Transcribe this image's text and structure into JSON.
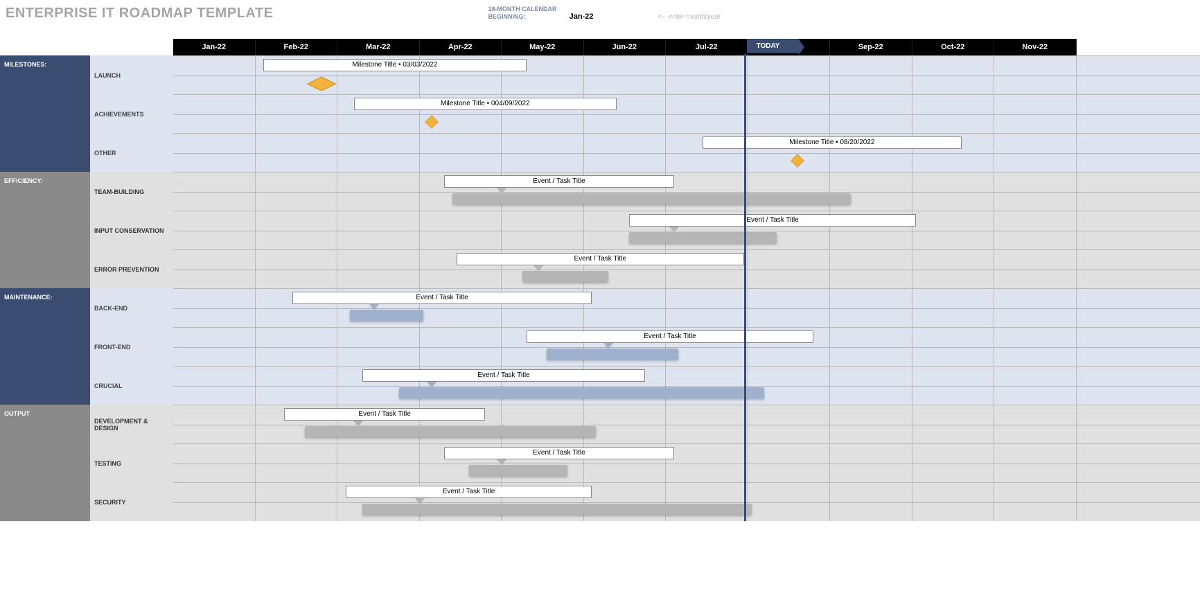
{
  "header": {
    "title": "ENTERPRISE IT ROADMAP TEMPLATE",
    "cal_line1": "18-MONTH CALENDAR",
    "cal_line2": "BEGINNING:",
    "beginning_value": "Jan-22",
    "hint": "<-- enter month/year"
  },
  "today": {
    "label": "TODAY",
    "month_index": 6.95
  },
  "months": [
    "Jan-22",
    "Feb-22",
    "Mar-22",
    "Apr-22",
    "May-22",
    "Jun-22",
    "Jul-22",
    "Aug-22",
    "Sep-22",
    "Oct-22",
    "Nov-22"
  ],
  "chart_data": {
    "type": "gantt",
    "x_unit": "month",
    "x_categories": [
      "Jan-22",
      "Feb-22",
      "Mar-22",
      "Apr-22",
      "May-22",
      "Jun-22",
      "Jul-22",
      "Aug-22",
      "Sep-22",
      "Oct-22",
      "Nov-22"
    ],
    "sections": [
      {
        "name": "MILESTONES:",
        "theme": "milestones",
        "rows": [
          {
            "name": "LAUNCH",
            "type": "milestone",
            "label": "Milestone Title  •  03/03/2022",
            "label_start": 1.1,
            "label_end": 4.3,
            "diamond_at": 1.8,
            "diamond_size": "large"
          },
          {
            "name": "ACHIEVEMENTS",
            "type": "milestone",
            "label": "Milestone Title  •  004/09/2022",
            "label_start": 2.2,
            "label_end": 5.4,
            "diamond_at": 3.15,
            "diamond_size": "small"
          },
          {
            "name": "OTHER",
            "type": "milestone",
            "label": "Milestone Title  •  08/20/2022",
            "label_start": 6.45,
            "label_end": 9.6,
            "diamond_at": 7.6,
            "diamond_size": "small"
          }
        ]
      },
      {
        "name": "EFFICIENCY:",
        "theme": "efficiency",
        "rows": [
          {
            "name": "TEAM-BUILDING",
            "type": "task",
            "color": "grey",
            "label": "Event / Task Title",
            "label_start": 3.3,
            "label_end": 6.1,
            "bar_start": 3.4,
            "bar_end": 8.25,
            "caret_at": 4.0
          },
          {
            "name": "INPUT CONSERVATION",
            "type": "task",
            "color": "grey",
            "label": "Event / Task Title",
            "label_start": 5.55,
            "label_end": 9.05,
            "bar_start": 5.55,
            "bar_end": 7.35,
            "caret_at": 6.1
          },
          {
            "name": "ERROR PREVENTION",
            "type": "task",
            "color": "grey",
            "label": "Event / Task Title",
            "label_start": 3.45,
            "label_end": 6.95,
            "bar_start": 4.25,
            "bar_end": 5.3,
            "caret_at": 4.45
          }
        ]
      },
      {
        "name": "MAINTENANCE:",
        "theme": "maintenance",
        "rows": [
          {
            "name": "BACK-END",
            "type": "task",
            "color": "blue",
            "label": "Event / Task Title",
            "label_start": 1.45,
            "label_end": 5.1,
            "bar_start": 2.15,
            "bar_end": 3.05,
            "caret_at": 2.45
          },
          {
            "name": "FRONT-END",
            "type": "task",
            "color": "blue",
            "label": "Event / Task Title",
            "label_start": 4.3,
            "label_end": 7.8,
            "bar_start": 4.55,
            "bar_end": 6.15,
            "caret_at": 5.3
          },
          {
            "name": "CRUCIAL",
            "type": "task",
            "color": "blue",
            "label": "Event / Task Title",
            "label_start": 2.3,
            "label_end": 5.75,
            "bar_start": 2.75,
            "bar_end": 7.2,
            "caret_at": 3.15
          }
        ]
      },
      {
        "name": "OUTPUT",
        "theme": "output",
        "rows": [
          {
            "name": "DEVELOPMENT & DESIGN",
            "type": "task",
            "color": "grey",
            "label": "Event / Task Title",
            "label_start": 1.35,
            "label_end": 3.8,
            "bar_start": 1.6,
            "bar_end": 5.15,
            "caret_at": 2.25
          },
          {
            "name": "TESTING",
            "type": "task",
            "color": "grey",
            "label": "Event / Task Title",
            "label_start": 3.3,
            "label_end": 6.1,
            "bar_start": 3.6,
            "bar_end": 4.8,
            "caret_at": 4.0
          },
          {
            "name": "SECURITY",
            "type": "task",
            "color": "grey",
            "label": "Event / Task Title",
            "label_start": 2.1,
            "label_end": 5.1,
            "bar_start": 2.3,
            "bar_end": 7.05,
            "caret_at": 3.0
          }
        ]
      }
    ]
  }
}
